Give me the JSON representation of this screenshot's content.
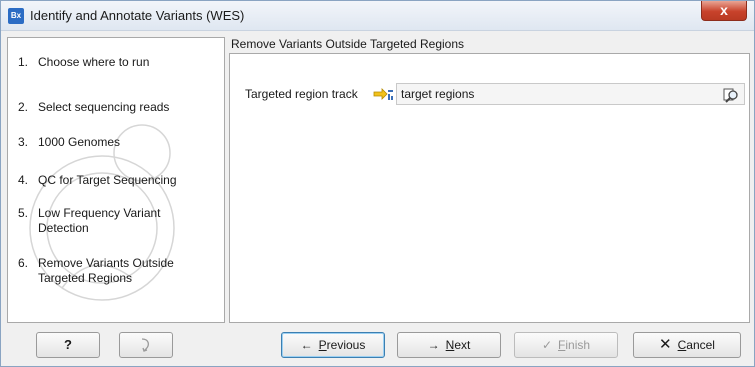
{
  "window": {
    "title": "Identify and Annotate Variants (WES)",
    "app_icon": "Bx",
    "close_glyph": "x"
  },
  "sidebar": {
    "steps": [
      {
        "num": "1.",
        "label": "Choose where to run"
      },
      {
        "num": "2.",
        "label": "Select sequencing reads"
      },
      {
        "num": "3.",
        "label": "1000 Genomes"
      },
      {
        "num": "4.",
        "label": "QC for Target Sequencing"
      },
      {
        "num": "5.",
        "label": "Low Frequency Variant Detection"
      },
      {
        "num": "6.",
        "label": "Remove Variants Outside Targeted Regions"
      }
    ]
  },
  "main": {
    "section_title": "Remove Variants Outside Targeted Regions",
    "field_label": "Targeted region track",
    "field_value": "target regions"
  },
  "buttons": {
    "help": "?",
    "previous": {
      "mnemonic": "P",
      "rest": "revious"
    },
    "next": {
      "mnemonic": "N",
      "rest": "ext"
    },
    "finish": {
      "mnemonic": "F",
      "rest": "inish"
    },
    "cancel": {
      "mnemonic": "C",
      "rest": "ancel"
    }
  },
  "icons": {
    "track": "track-icon",
    "browse": "browse-icon",
    "reset": "reset-icon"
  },
  "colors": {
    "accent": "#3c7fb1",
    "close": "#c8422b"
  }
}
